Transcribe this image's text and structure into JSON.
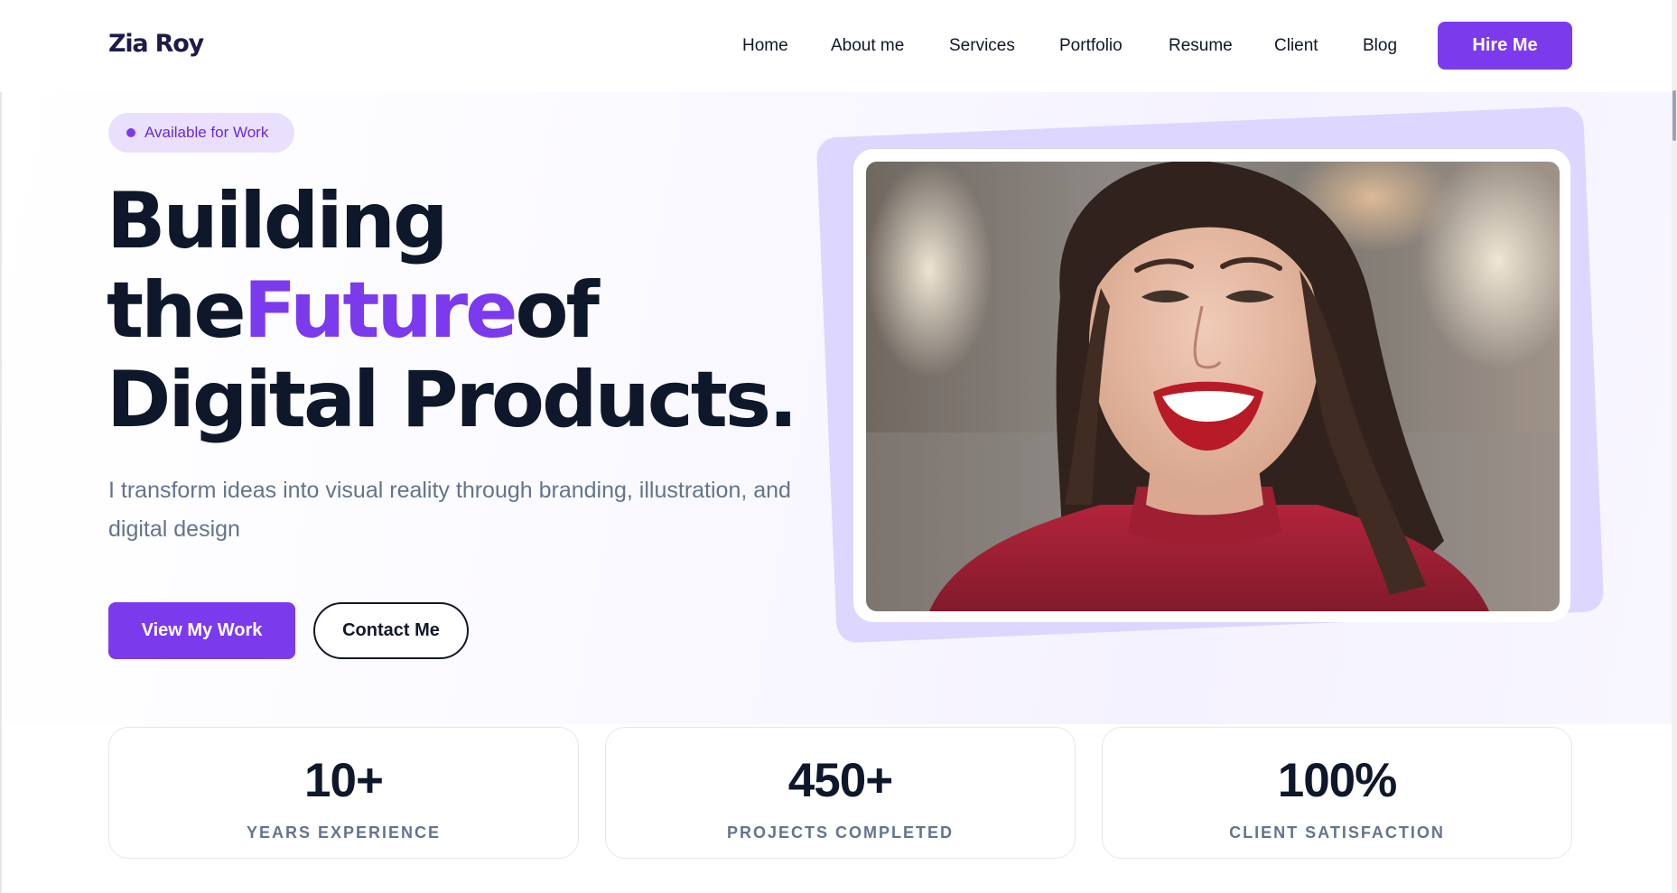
{
  "header": {
    "logo": "Zia Roy",
    "nav": [
      {
        "label": "Home"
      },
      {
        "label": "About me"
      },
      {
        "label": "Services"
      },
      {
        "label": "Portfolio"
      },
      {
        "label": "Resume"
      },
      {
        "label": "Client"
      },
      {
        "label": "Blog"
      }
    ],
    "hire_label": "Hire Me"
  },
  "hero": {
    "badge": "Available for Work",
    "headline": {
      "line1": "Building",
      "line2_pre": "the",
      "line2_accent": "Future",
      "line2_post": "of",
      "line3": "Digital Products."
    },
    "subtitle": "I transform ideas into visual reality through branding, illustration, and digital design",
    "primary_button": "View My Work",
    "secondary_button": "Contact Me"
  },
  "stats": [
    {
      "value": "10+",
      "label": "YEARS EXPERIENCE"
    },
    {
      "value": "450+",
      "label": "PROJECTS COMPLETED"
    },
    {
      "value": "100%",
      "label": "CLIENT SATISFACTION"
    }
  ],
  "colors": {
    "accent": "#7c3aed",
    "accent_light": "#ddd6fe",
    "text_dark": "#0f172a",
    "text_muted": "#64748b"
  }
}
